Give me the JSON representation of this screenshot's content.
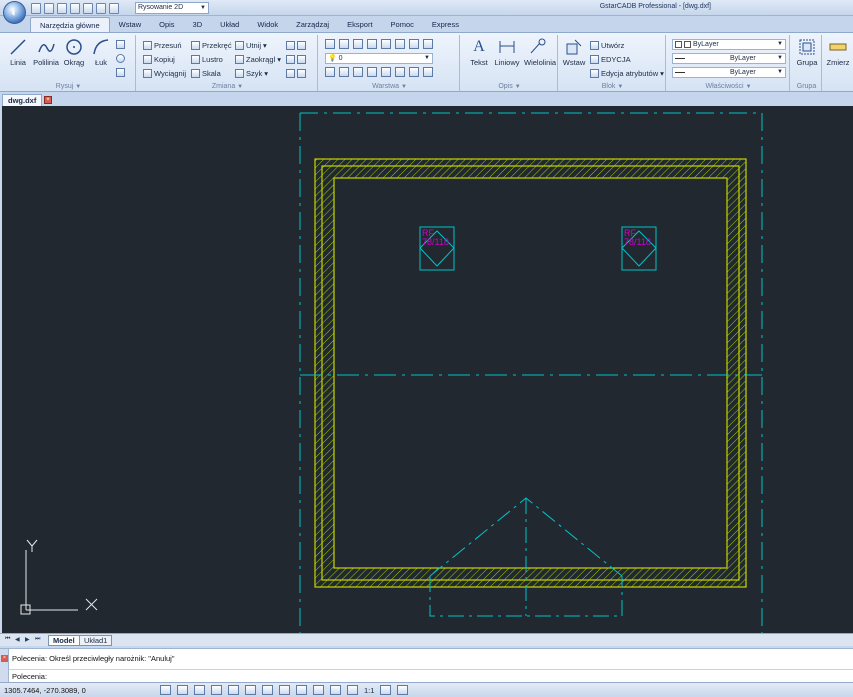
{
  "app": {
    "window_title": "GstarCADB Professional - [dwg.dxf]",
    "workspace": "Rysowanie 2D"
  },
  "menu": {
    "tabs": [
      "Narzędzia główne",
      "Wstaw",
      "Opis",
      "3D",
      "Układ",
      "Widok",
      "Zarządzaj",
      "Eksport",
      "Pomoc",
      "Express"
    ],
    "active": "Narzędzia główne"
  },
  "ribbon": {
    "rysuj": {
      "label": "Rysuj",
      "linia": "Linia",
      "polilinia": "Polilinia",
      "okrag": "Okrąg",
      "luk": "Łuk"
    },
    "zmiana": {
      "label": "Zmiana",
      "przesun": "Przesuń",
      "kopiuj": "Kopiuj",
      "wyciagnij": "Wyciągnij",
      "przekrec": "Przekręć",
      "lustro": "Lustro",
      "skala": "Skala",
      "utnij": "Utnij",
      "zaokraglij": "Zaokrągl",
      "szyk": "Szyk"
    },
    "warstwa": {
      "label": "Warstwa",
      "current_layer": "0"
    },
    "opis": {
      "label": "Opis",
      "tekst": "Tekst",
      "liniowy": "Liniowy",
      "wielolinia": "Wielolinia"
    },
    "blok": {
      "label": "Blok",
      "wstaw": "Wstaw",
      "utworz": "Utwórz",
      "edycja": "EDYCJA",
      "edycja_atrybutow": "Edycja atrybutów"
    },
    "wlasciwosci": {
      "label": "Właściwości",
      "color": "ByLayer",
      "linetype": "ByLayer",
      "lineweight": "ByLayer"
    },
    "grupa": {
      "label": "Grupa",
      "button": "Grupa"
    },
    "zmierz": {
      "button": "Zmierz"
    }
  },
  "document": {
    "tab": "dwg.dxf"
  },
  "drawing": {
    "label_line1": "RF",
    "label_line2": "78/118",
    "colors": {
      "background": "#212830",
      "cyan": "#00c4c8",
      "wall": "#c8d400",
      "hatch": "#9cd100",
      "magenta": "#d000d0",
      "ucs": "#e6e6e6"
    }
  },
  "layout_tabs": {
    "model": "Model",
    "layout1": "Układ1"
  },
  "command": {
    "history": "Polecenia: Określ przeciwległy narożnik: \"Anuluj\"",
    "prompt": "Polecenia:"
  },
  "status": {
    "coordinates": "1305.7464, -270.3089, 0",
    "scale": "1:1"
  }
}
